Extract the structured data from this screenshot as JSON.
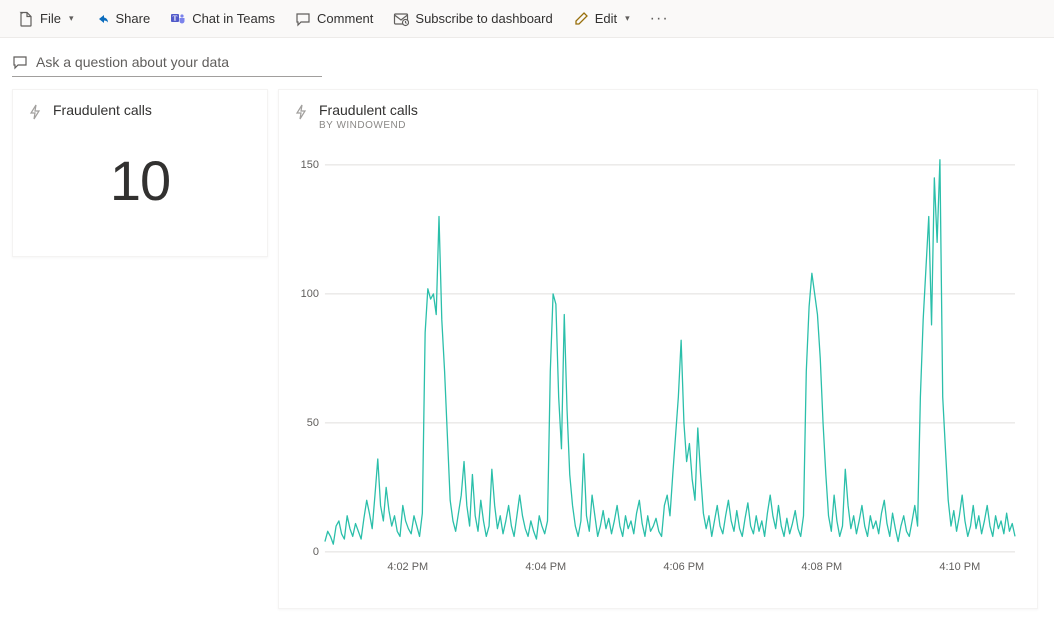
{
  "toolbar": {
    "file": "File",
    "share": "Share",
    "teams": "Chat in Teams",
    "comment": "Comment",
    "subscribe": "Subscribe to dashboard",
    "edit": "Edit"
  },
  "qa_placeholder": "Ask a question about your data",
  "tile_small": {
    "title": "Fraudulent calls",
    "value": "10"
  },
  "tile_large": {
    "title": "Fraudulent calls",
    "subtitle": "BY WINDOWEND"
  },
  "chart_data": {
    "type": "line",
    "title": "Fraudulent calls",
    "xlabel": "",
    "ylabel": "",
    "ylim": [
      0,
      155
    ],
    "y_ticks": [
      0,
      50,
      100,
      150
    ],
    "x_ticks": [
      "4:02 PM",
      "4:04 PM",
      "4:06 PM",
      "4:08 PM",
      "4:10 PM"
    ],
    "series": [
      {
        "name": "Fraudulent calls",
        "values": [
          4,
          8,
          6,
          3,
          10,
          12,
          7,
          5,
          14,
          9,
          6,
          11,
          8,
          5,
          13,
          20,
          15,
          9,
          22,
          36,
          18,
          12,
          25,
          16,
          10,
          14,
          8,
          6,
          18,
          12,
          9,
          7,
          14,
          10,
          6,
          15,
          85,
          102,
          98,
          100,
          92,
          130,
          90,
          70,
          45,
          20,
          12,
          8,
          15,
          22,
          35,
          18,
          10,
          30,
          14,
          8,
          20,
          12,
          6,
          10,
          32,
          18,
          9,
          14,
          7,
          12,
          18,
          10,
          6,
          14,
          22,
          14,
          9,
          6,
          12,
          8,
          5,
          14,
          10,
          7,
          12,
          70,
          100,
          96,
          60,
          40,
          92,
          55,
          30,
          18,
          10,
          6,
          12,
          38,
          14,
          8,
          22,
          14,
          6,
          10,
          16,
          9,
          13,
          7,
          12,
          18,
          10,
          6,
          14,
          9,
          12,
          7,
          15,
          20,
          11,
          6,
          14,
          8,
          10,
          13,
          8,
          6,
          18,
          22,
          14,
          30,
          45,
          60,
          82,
          50,
          35,
          42,
          28,
          20,
          48,
          30,
          15,
          9,
          14,
          6,
          12,
          18,
          10,
          7,
          14,
          20,
          12,
          8,
          16,
          9,
          6,
          13,
          19,
          10,
          7,
          14,
          8,
          12,
          6,
          15,
          22,
          14,
          9,
          18,
          10,
          6,
          13,
          7,
          11,
          16,
          9,
          6,
          14,
          70,
          95,
          108,
          100,
          92,
          75,
          50,
          30,
          14,
          8,
          22,
          12,
          6,
          10,
          32,
          18,
          9,
          14,
          7,
          12,
          18,
          10,
          6,
          14,
          9,
          12,
          7,
          15,
          20,
          11,
          6,
          15,
          9,
          4,
          10,
          14,
          8,
          6,
          12,
          18,
          10,
          60,
          90,
          110,
          130,
          88,
          145,
          120,
          152,
          60,
          40,
          20,
          10,
          16,
          8,
          14,
          22,
          12,
          6,
          10,
          18,
          9,
          14,
          7,
          12,
          18,
          10,
          6,
          14,
          9,
          12,
          7,
          15,
          8,
          11,
          6
        ]
      }
    ]
  }
}
